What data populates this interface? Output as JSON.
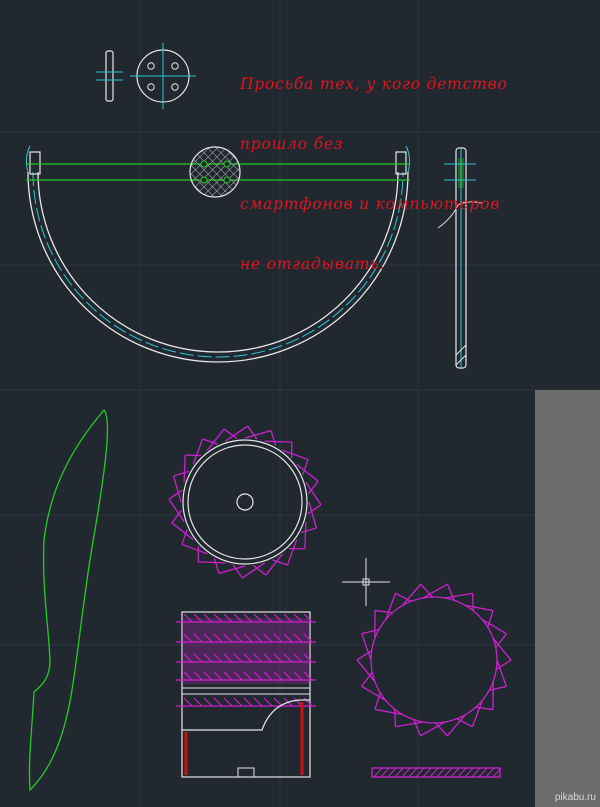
{
  "note": {
    "lines": [
      "Просьба тех, у кого детство",
      "прошло без",
      "смартфонов и компьютеров",
      "не отгадывать."
    ],
    "color": "#e0141e"
  },
  "watermark": "pikabu.ru",
  "colors": {
    "background": "#212830",
    "grid": "#2c3440",
    "outline": "#e6e6e6",
    "centerline": "#2ec9d6",
    "green": "#22cc22",
    "magenta": "#cc22cc",
    "red": "#cc1111",
    "panel": "#6b6b6b"
  }
}
